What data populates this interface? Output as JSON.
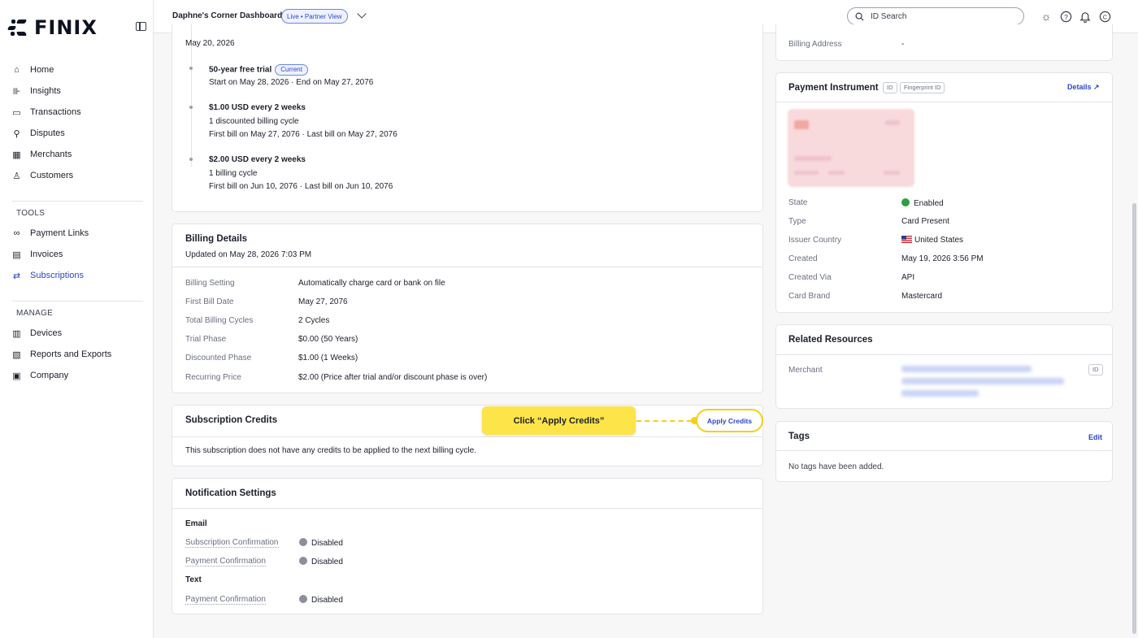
{
  "brand": {
    "name": "FINIX"
  },
  "sidebar": {
    "items": [
      {
        "label": "Home",
        "icon": "home-icon",
        "glyph": "⌂"
      },
      {
        "label": "Insights",
        "icon": "chart-icon",
        "glyph": "⊪"
      },
      {
        "label": "Transactions",
        "icon": "credit-card-icon",
        "glyph": "▭"
      },
      {
        "label": "Disputes",
        "icon": "magnifier-icon",
        "glyph": "⚲"
      },
      {
        "label": "Merchants",
        "icon": "store-icon",
        "glyph": "▦"
      },
      {
        "label": "Customers",
        "icon": "person-icon",
        "glyph": "♙"
      }
    ],
    "tools_label": "TOOLS",
    "tools": [
      {
        "label": "Payment Links",
        "icon": "link-icon",
        "glyph": "∞"
      },
      {
        "label": "Invoices",
        "icon": "document-icon",
        "glyph": "▤"
      },
      {
        "label": "Subscriptions",
        "icon": "refresh-icon",
        "glyph": "⇄"
      }
    ],
    "manage_label": "MANAGE",
    "manage": [
      {
        "label": "Devices",
        "icon": "device-icon",
        "glyph": "▥"
      },
      {
        "label": "Reports and Exports",
        "icon": "report-icon",
        "glyph": "▧"
      },
      {
        "label": "Company",
        "icon": "building-icon",
        "glyph": "▣"
      }
    ]
  },
  "header": {
    "title": "Daphne's Corner Dashboard",
    "env_badge": "Live • Partner View",
    "search_placeholder": "ID Search"
  },
  "timeline": {
    "top_date": "May 20, 2026",
    "phases": [
      {
        "title": "50-year free trial",
        "tag": "Current",
        "lines": [
          "Start on May 28, 2026 · End on May 27, 2076"
        ]
      },
      {
        "title": "$1.00 USD every 2 weeks",
        "tag": "",
        "lines": [
          "1 discounted billing cycle",
          "First bill on May 27, 2076 · Last bill on May 27, 2076"
        ]
      },
      {
        "title": "$2.00 USD every 2 weeks",
        "tag": "",
        "lines": [
          "1 billing cycle",
          "First bill on Jun 10, 2076 · Last bill on Jun 10, 2076"
        ]
      }
    ]
  },
  "billing_details": {
    "title": "Billing Details",
    "updated": "Updated on May 28, 2026 7:03 PM",
    "rows": [
      {
        "label": "Billing Setting",
        "value": "Automatically charge card or bank on file"
      },
      {
        "label": "First Bill Date",
        "value": "May 27, 2076"
      },
      {
        "label": "Total Billing Cycles",
        "value": "2 Cycles"
      },
      {
        "label": "Trial Phase",
        "value": "$0.00 (50 Years)"
      },
      {
        "label": "Discounted Phase",
        "value": "$1.00 (1 Weeks)"
      },
      {
        "label": "Recurring Price",
        "value": "$2.00 (Price after trial and/or discount phase is over)"
      }
    ]
  },
  "credits": {
    "title": "Subscription Credits",
    "apply_label": "Apply Credits",
    "empty_text": "This subscription does not have any credits to be applied to the next billing cycle.",
    "callout": "Click “Apply Credits”"
  },
  "notifications": {
    "title": "Notification Settings",
    "email_label": "Email",
    "text_label": "Text",
    "email_rows": [
      {
        "label": "Subscription Confirmation",
        "value": "Disabled"
      },
      {
        "label": "Payment Confirmation",
        "value": "Disabled"
      }
    ],
    "text_rows": [
      {
        "label": "Payment Confirmation",
        "value": "Disabled"
      }
    ]
  },
  "billing_address": {
    "label": "Billing Address",
    "value": "-"
  },
  "payment_instrument": {
    "title": "Payment Instrument",
    "id_badge": "ID",
    "fingerprint_badge": "Fingerprint ID",
    "details_label": "Details",
    "rows": [
      {
        "label": "State",
        "value": "Enabled"
      },
      {
        "label": "Type",
        "value": "Card Present"
      },
      {
        "label": "Issuer Country",
        "value": "United States"
      },
      {
        "label": "Created",
        "value": "May 19, 2026 3:56 PM"
      },
      {
        "label": "Created Via",
        "value": "API"
      },
      {
        "label": "Card Brand",
        "value": "Mastercard"
      }
    ]
  },
  "related": {
    "title": "Related Resources",
    "merchant_label": "Merchant",
    "id_badge": "ID"
  },
  "tags": {
    "title": "Tags",
    "edit_label": "Edit",
    "empty_text": "No tags have been added."
  },
  "colors": {
    "accent": "#2c47c7",
    "highlight": "#fde448",
    "enabled": "#2f9e44",
    "disabled": "#6b7080"
  }
}
